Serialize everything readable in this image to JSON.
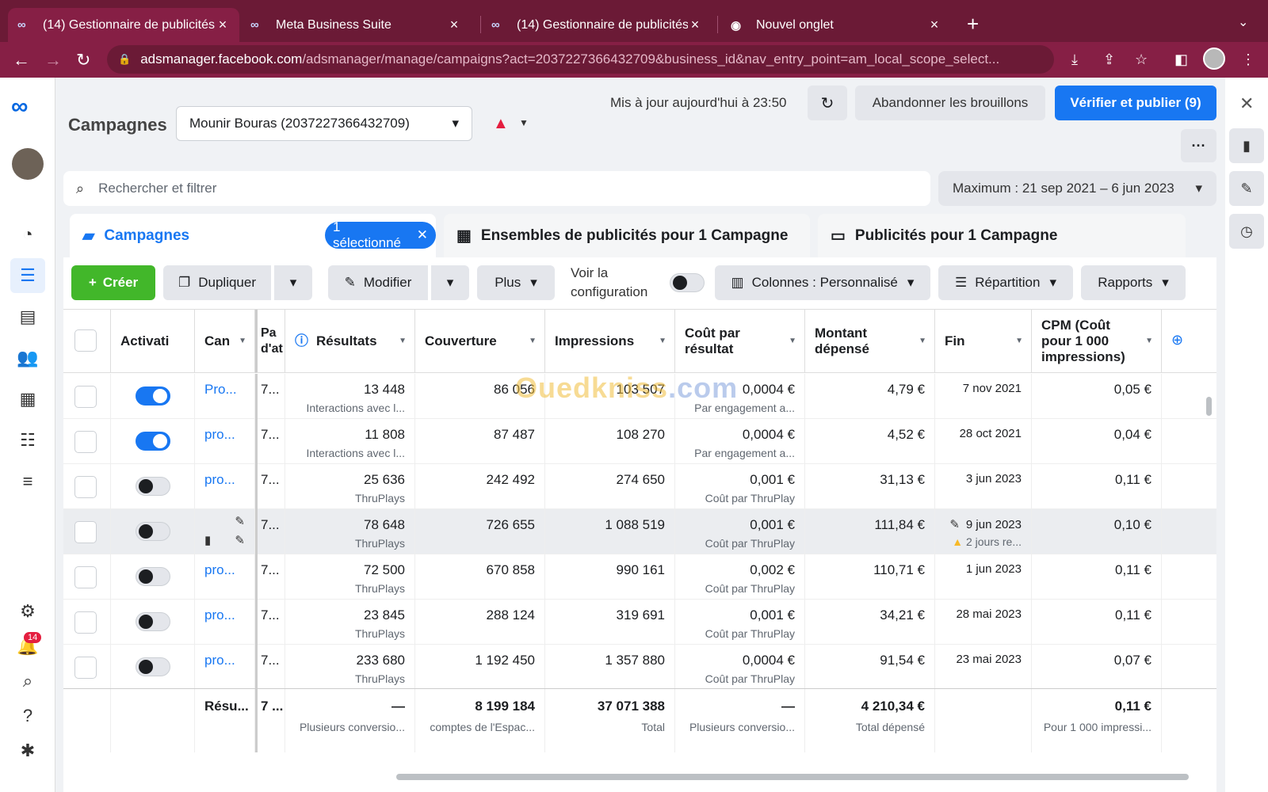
{
  "browser": {
    "tabs": [
      {
        "title": "(14) Gestionnaire de publicités",
        "icon": "meta-icon"
      },
      {
        "title": "Meta Business Suite",
        "icon": "meta-icon"
      },
      {
        "title": "(14) Gestionnaire de publicités",
        "icon": "meta-icon"
      },
      {
        "title": "Nouvel onglet",
        "icon": "chrome-icon"
      }
    ],
    "url_host": "adsmanager.facebook.com",
    "url_path": "/adsmanager/manage/campaigns?act=2037227366432709&business_id&nav_entry_point=am_local_scope_select..."
  },
  "leftnav": {
    "notifications_count": "14"
  },
  "header": {
    "title": "Campagnes",
    "account": "Mounir Bouras (2037227366432709)",
    "updated": "Mis à jour aujourd'hui à 23:50",
    "discard": "Abandonner les brouillons",
    "publish": "Vérifier et publier (9)",
    "more": "···"
  },
  "search": {
    "placeholder": "Rechercher et filtrer",
    "date_range": "Maximum : 21 sep 2021 – 6 jun 2023"
  },
  "levels": {
    "campaigns": "Campagnes",
    "selected": "1 sélectionné",
    "adsets": "Ensembles de publicités pour 1 Campagne",
    "ads": "Publicités pour 1 Campagne"
  },
  "actions": {
    "create": "Créer",
    "duplicate": "Dupliquer",
    "edit": "Modifier",
    "more": "Plus",
    "config_line1": "Voir la",
    "config_line2": "configuration",
    "columns": "Colonnes : Personnalisé",
    "breakdown": "Répartition",
    "reports": "Rapports"
  },
  "table": {
    "headers": {
      "activation": "Activati",
      "campaign": "Can",
      "attribution": "Pa d'at",
      "results": "Résultats",
      "reach": "Couverture",
      "impressions": "Impressions",
      "cost_per_result": "Coût par résultat",
      "spent": "Montant dépensé",
      "end": "Fin",
      "cpm": "CPM (Coût pour 1 000 impressions)"
    },
    "rows": [
      {
        "name": "Pro...",
        "attr": "7...",
        "results": "13 448",
        "results_sub": "Interactions avec l...",
        "reach": "86 056",
        "impressions": "103 507",
        "cpr": "0,0004 €",
        "cpr_sub": "Par engagement a...",
        "spent": "4,79 €",
        "end": "7 nov 2021",
        "end_sub": "",
        "cpm": "0,05 €",
        "active": true
      },
      {
        "name": "pro...",
        "attr": "7...",
        "results": "11 808",
        "results_sub": "Interactions avec l...",
        "reach": "87 487",
        "impressions": "108 270",
        "cpr": "0,0004 €",
        "cpr_sub": "Par engagement a...",
        "spent": "4,52 €",
        "end": "28 oct 2021",
        "end_sub": "",
        "cpm": "0,04 €",
        "active": true
      },
      {
        "name": "pro...",
        "attr": "7...",
        "results": "25 636",
        "results_sub": "ThruPlays",
        "reach": "242 492",
        "impressions": "274 650",
        "cpr": "0,001 €",
        "cpr_sub": "Coût par ThruPlay",
        "spent": "31,13 €",
        "end": "3 jun 2023",
        "end_sub": "",
        "cpm": "0,11 €",
        "active": false
      },
      {
        "name": "",
        "attr": "7...",
        "results": "78 648",
        "results_sub": "ThruPlays",
        "reach": "726 655",
        "impressions": "1 088 519",
        "cpr": "0,001 €",
        "cpr_sub": "Coût par ThruPlay",
        "spent": "111,84 €",
        "end": "9 jun 2023",
        "end_sub": "2 jours re...",
        "cpm": "0,10 €",
        "active": false
      },
      {
        "name": "pro...",
        "attr": "7...",
        "results": "72 500",
        "results_sub": "ThruPlays",
        "reach": "670 858",
        "impressions": "990 161",
        "cpr": "0,002 €",
        "cpr_sub": "Coût par ThruPlay",
        "spent": "110,71 €",
        "end": "1 jun 2023",
        "end_sub": "",
        "cpm": "0,11 €",
        "active": false
      },
      {
        "name": "pro...",
        "attr": "7...",
        "results": "23 845",
        "results_sub": "ThruPlays",
        "reach": "288 124",
        "impressions": "319 691",
        "cpr": "0,001 €",
        "cpr_sub": "Coût par ThruPlay",
        "spent": "34,21 €",
        "end": "28 mai 2023",
        "end_sub": "",
        "cpm": "0,11 €",
        "active": false
      },
      {
        "name": "pro...",
        "attr": "7...",
        "results": "233 680",
        "results_sub": "ThruPlays",
        "reach": "1 192 450",
        "impressions": "1 357 880",
        "cpr": "0,0004 €",
        "cpr_sub": "Coût par ThruPlay",
        "spent": "91,54 €",
        "end": "23 mai 2023",
        "end_sub": "",
        "cpm": "0,07 €",
        "active": false
      }
    ],
    "totals": {
      "label": "Résu...",
      "attr": "7 ...",
      "results": "—",
      "results_sub": "Plusieurs conversio...",
      "reach": "8 199 184",
      "reach_sub": "comptes de l'Espac...",
      "impressions": "37 071 388",
      "impressions_sub": "Total",
      "cpr": "—",
      "cpr_sub": "Plusieurs conversio...",
      "spent": "4 210,34 €",
      "spent_sub": "Total dépensé",
      "cpm": "0,11 €",
      "cpm_sub": "Pour 1 000 impressi..."
    }
  },
  "watermark": {
    "main": "Ouedkniss",
    "suffix": ".com"
  },
  "colors": {
    "brand": "#1877f2",
    "create": "#42b72a",
    "browser": "#861f45"
  }
}
